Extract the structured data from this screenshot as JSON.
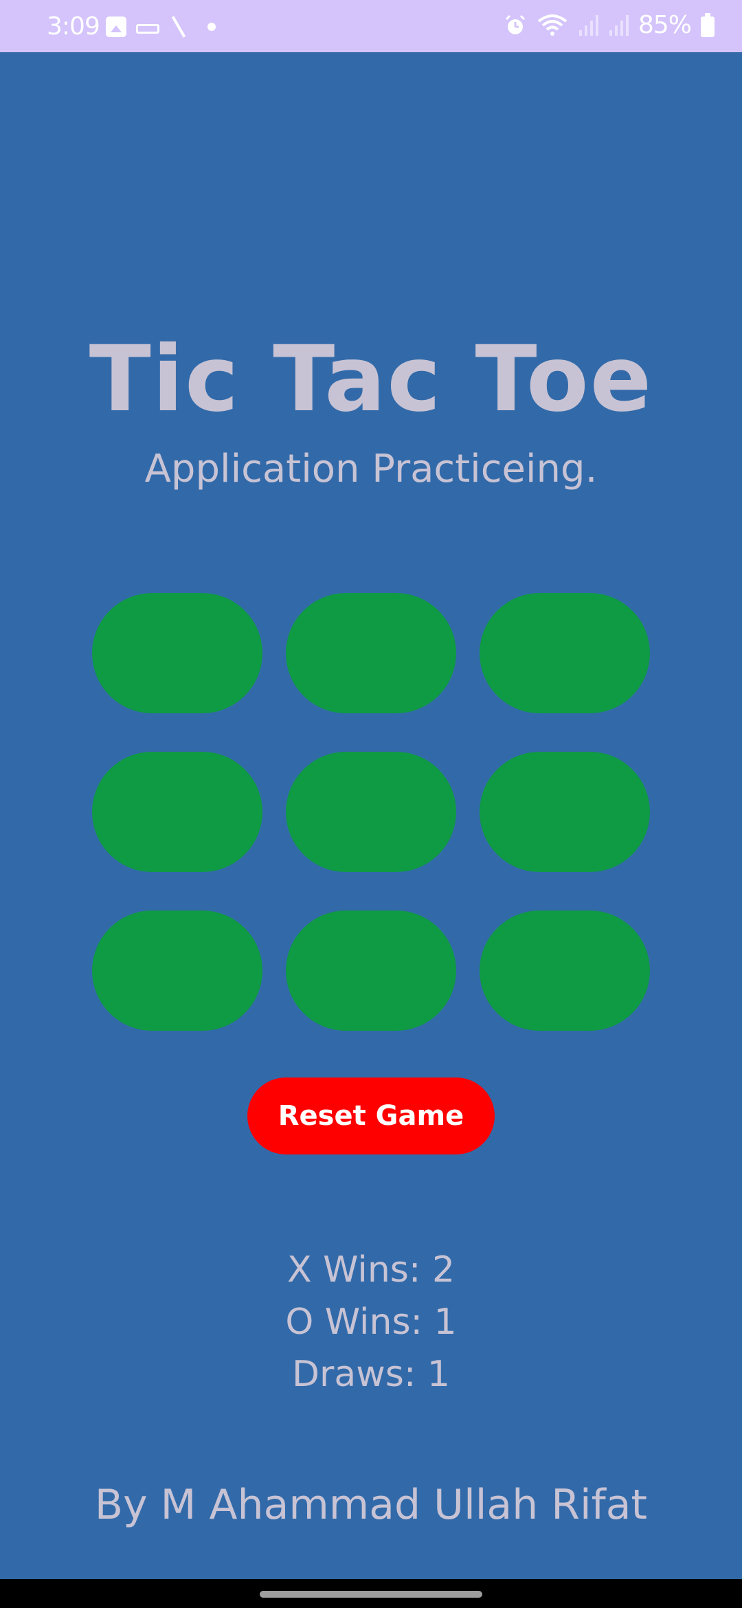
{
  "status_bar": {
    "time": "3:09",
    "battery": "85%",
    "left_icons": [
      "gallery-icon",
      "hdmi-icon",
      "pen-icon",
      "notification-dot-icon"
    ],
    "right_icons": [
      "alarm-icon",
      "wifi-icon",
      "signal-icon",
      "signal-icon",
      "battery-icon"
    ]
  },
  "app": {
    "title": "Tic Tac Toe",
    "subtitle": "Application Practiceing."
  },
  "board": {
    "cells": [
      "",
      "",
      "",
      "",
      "",
      "",
      "",
      "",
      ""
    ],
    "cell_color": "#0f9a44"
  },
  "reset": {
    "label": "Reset Game",
    "color": "#ff0000"
  },
  "scores": {
    "x_wins": "X Wins: 2",
    "o_wins": "O Wins: 1",
    "draws": "Draws: 1"
  },
  "credit": "By M Ahammad Ullah Rifat",
  "colors": {
    "background": "#326aa9",
    "status_bar": "#d4c4fb",
    "text": "#c8c3d4"
  }
}
